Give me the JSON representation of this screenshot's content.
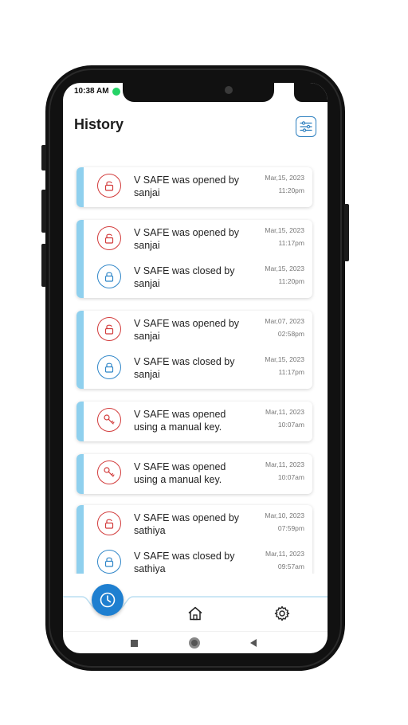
{
  "status": {
    "time": "10:38 AM"
  },
  "header": {
    "title": "History"
  },
  "colors": {
    "accent": "#1e7fd0",
    "opened": "#d23b3b",
    "closed": "#2f86c8",
    "card_bar": "#8fd0ee"
  },
  "groups": [
    {
      "entries": [
        {
          "type": "opened",
          "icon": "unlock-icon",
          "text": "V SAFE was opened by sanjai",
          "date": "Mar,15, 2023",
          "time": "11:20pm"
        }
      ]
    },
    {
      "entries": [
        {
          "type": "opened",
          "icon": "unlock-icon",
          "text": "V SAFE was opened by sanjai",
          "date": "Mar,15, 2023",
          "time": "11:17pm"
        },
        {
          "type": "closed",
          "icon": "lock-icon",
          "text": "V SAFE was closed by sanjai",
          "date": "Mar,15, 2023",
          "time": "11:20pm"
        }
      ]
    },
    {
      "entries": [
        {
          "type": "opened",
          "icon": "unlock-icon",
          "text": "V SAFE was opened by sanjai",
          "date": "Mar,07, 2023",
          "time": "02:58pm"
        },
        {
          "type": "closed",
          "icon": "lock-icon",
          "text": "V SAFE was closed by sanjai",
          "date": "Mar,15, 2023",
          "time": "11:17pm"
        }
      ]
    },
    {
      "entries": [
        {
          "type": "key",
          "icon": "key-icon",
          "text": "V SAFE was opened using a manual key.",
          "date": "Mar,11, 2023",
          "time": "10:07am"
        }
      ]
    },
    {
      "entries": [
        {
          "type": "key",
          "icon": "key-icon",
          "text": "V SAFE was opened using a manual key.",
          "date": "Mar,11, 2023",
          "time": "10:07am"
        }
      ]
    },
    {
      "entries": [
        {
          "type": "opened",
          "icon": "unlock-icon",
          "text": "V SAFE was opened by sathiya",
          "date": "Mar,10, 2023",
          "time": "07:59pm"
        },
        {
          "type": "closed",
          "icon": "lock-icon",
          "text": "V SAFE was closed by sathiya",
          "date": "Mar,11, 2023",
          "time": "09:57am"
        }
      ]
    }
  ],
  "nav": {
    "items": [
      {
        "icon": "history-icon",
        "active": true
      },
      {
        "icon": "home-icon",
        "active": false
      },
      {
        "icon": "settings-icon",
        "active": false
      }
    ]
  }
}
